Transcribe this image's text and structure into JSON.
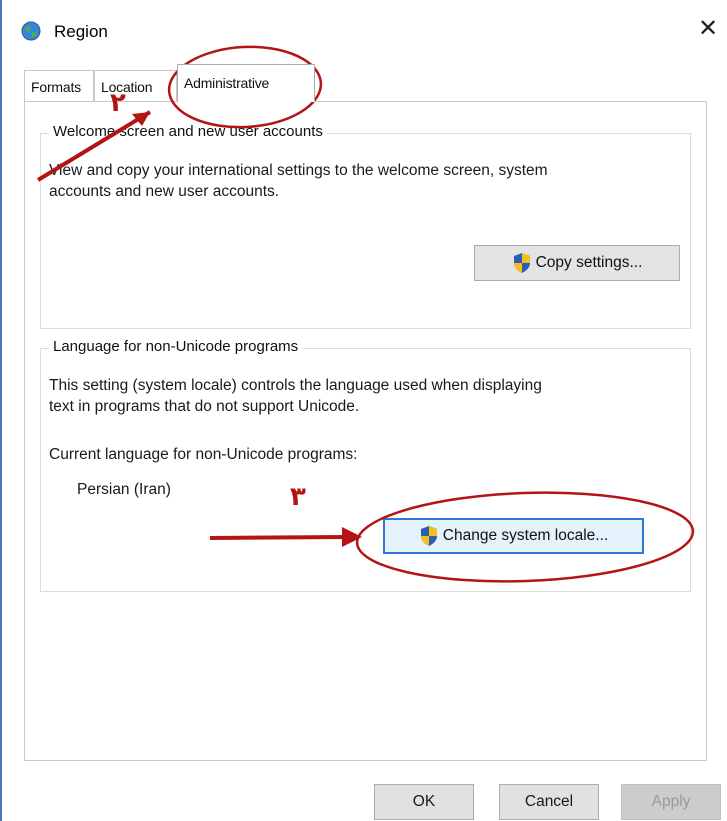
{
  "window": {
    "title": "Region",
    "close_glyph": "✕"
  },
  "tabs": [
    {
      "label": "Formats"
    },
    {
      "label": "Location"
    },
    {
      "label": "Administrative",
      "selected": true
    }
  ],
  "welcome": {
    "group_title": "Welcome screen and new user accounts",
    "line1": "View and copy your international settings to the welcome screen, system",
    "line2": "accounts and new user accounts.",
    "copy_button": "Copy settings..."
  },
  "nonunicode": {
    "group_title": "Language for non-Unicode programs",
    "line1": "This setting (system locale) controls the language used when displaying",
    "line2": "text in programs that do not support Unicode.",
    "current_label": "Current language for non-Unicode programs:",
    "current_value": "Persian (Iran)",
    "change_button": "Change system locale..."
  },
  "footer": {
    "ok": "OK",
    "cancel": "Cancel",
    "apply": "Apply"
  },
  "annotations": {
    "step2": "٢",
    "step3": "٣",
    "color": "#b41414"
  },
  "icons": {
    "title": "globe-icon",
    "uac": "uac-shield-icon"
  }
}
